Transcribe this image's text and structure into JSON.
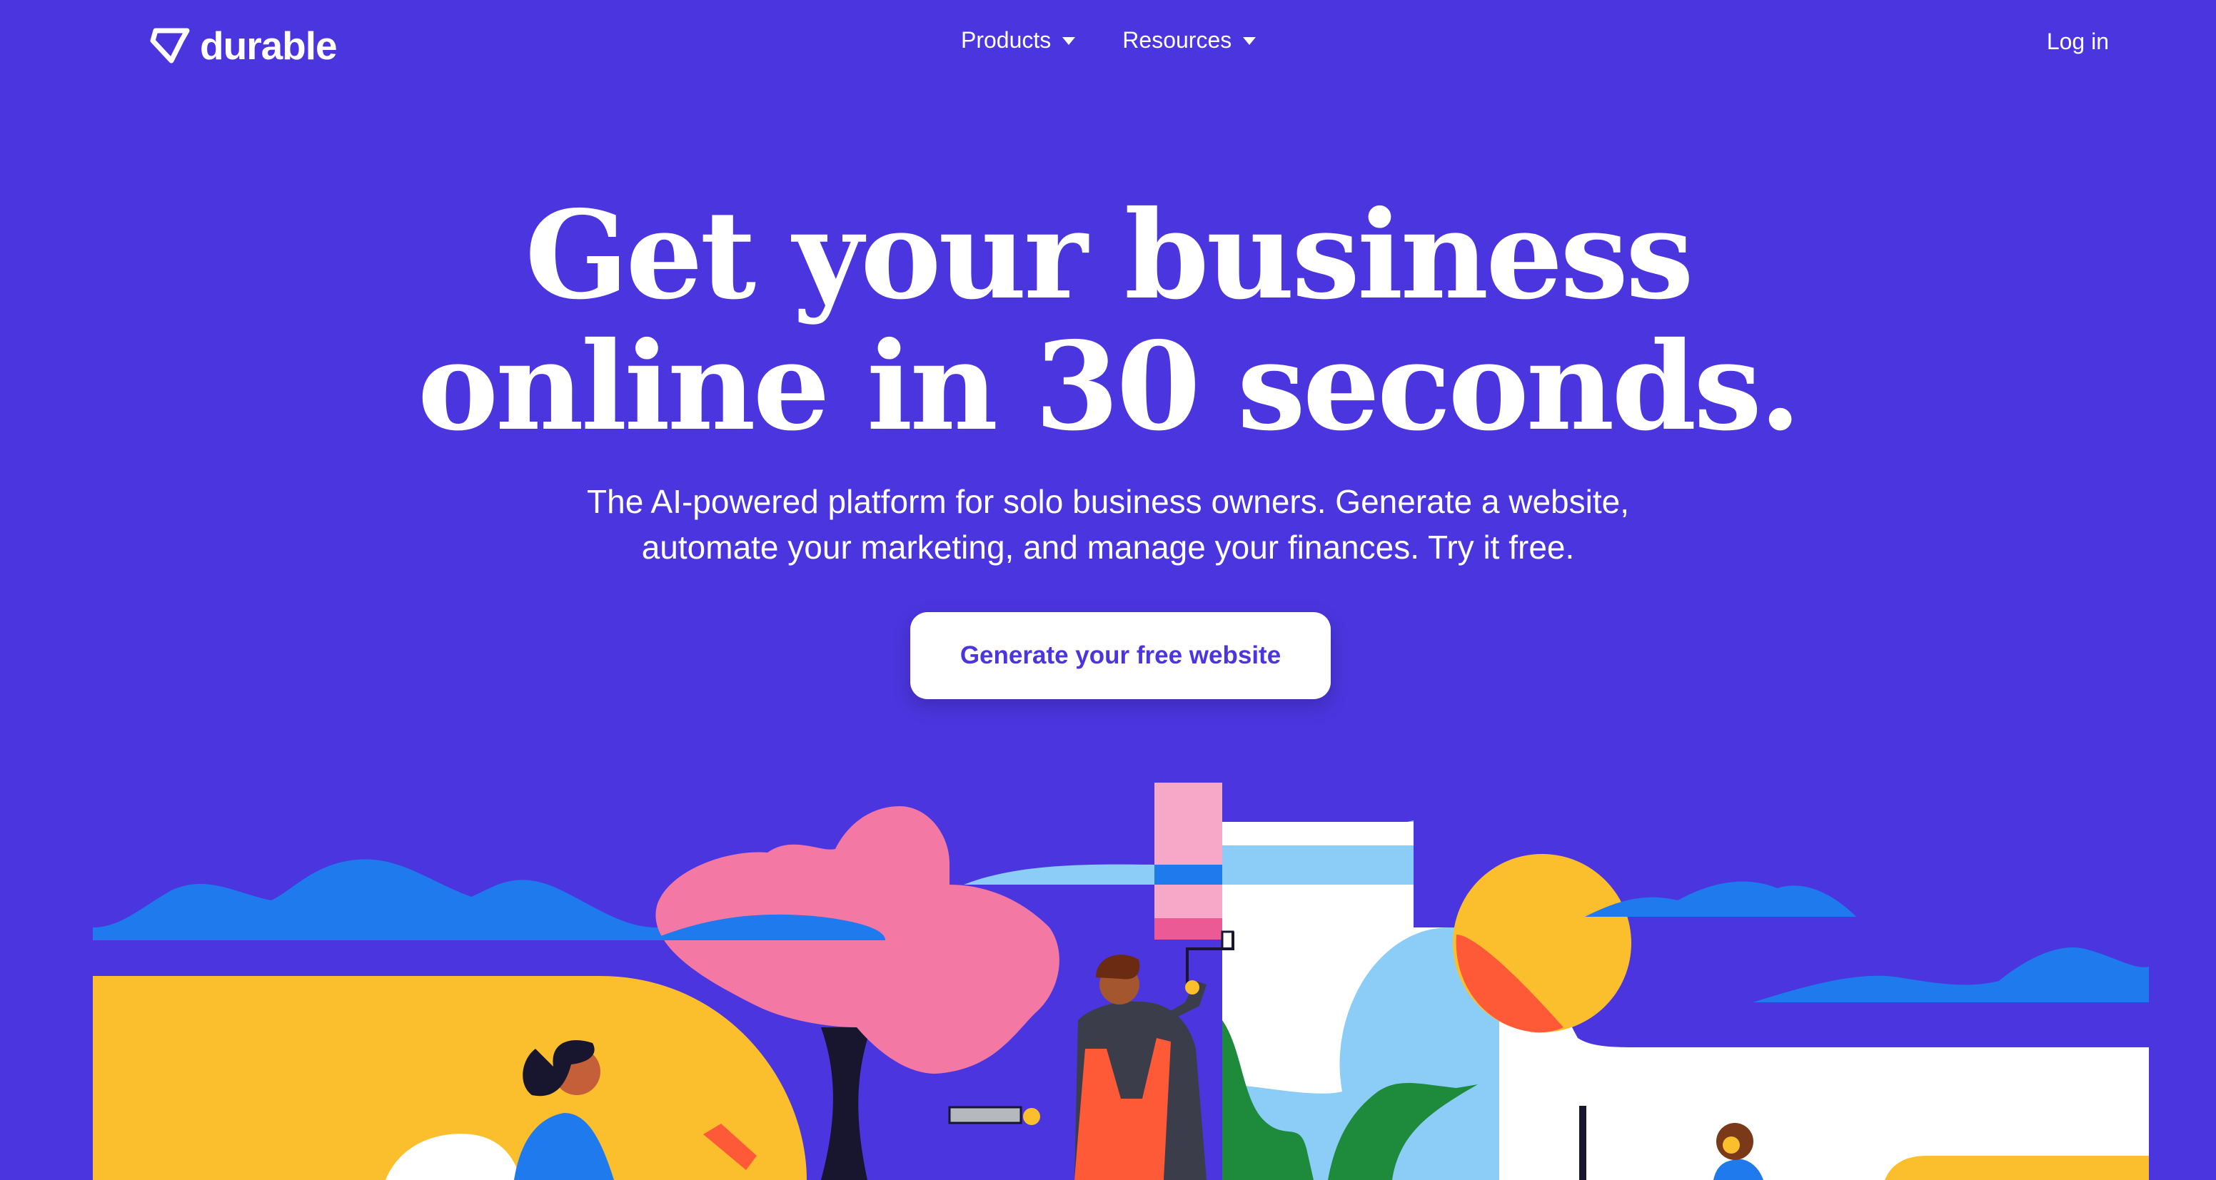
{
  "nav": {
    "brand": "durable",
    "menu": [
      {
        "label": "Products"
      },
      {
        "label": "Resources"
      }
    ],
    "login_label": "Log in"
  },
  "hero": {
    "headline_line1": "Get your business",
    "headline_line2": "online in 30 seconds.",
    "subtitle_line1": "The AI-powered platform for solo business owners. Generate a website,",
    "subtitle_line2": "automate your marketing, and manage your finances. Try it free.",
    "cta_label": "Generate your free website"
  },
  "colors": {
    "background": "#4b35de",
    "cta_text": "#4b35de",
    "yellow": "#fbbe2c",
    "pink": "#f478a4",
    "sky_blue": "#8bcdf7",
    "cloud_blue": "#1f7aee",
    "green": "#1e8a3c",
    "orange": "#ff5a38"
  },
  "icons": {
    "logo": "durable-diamond-logo-icon",
    "dropdown": "caret-down-icon"
  }
}
